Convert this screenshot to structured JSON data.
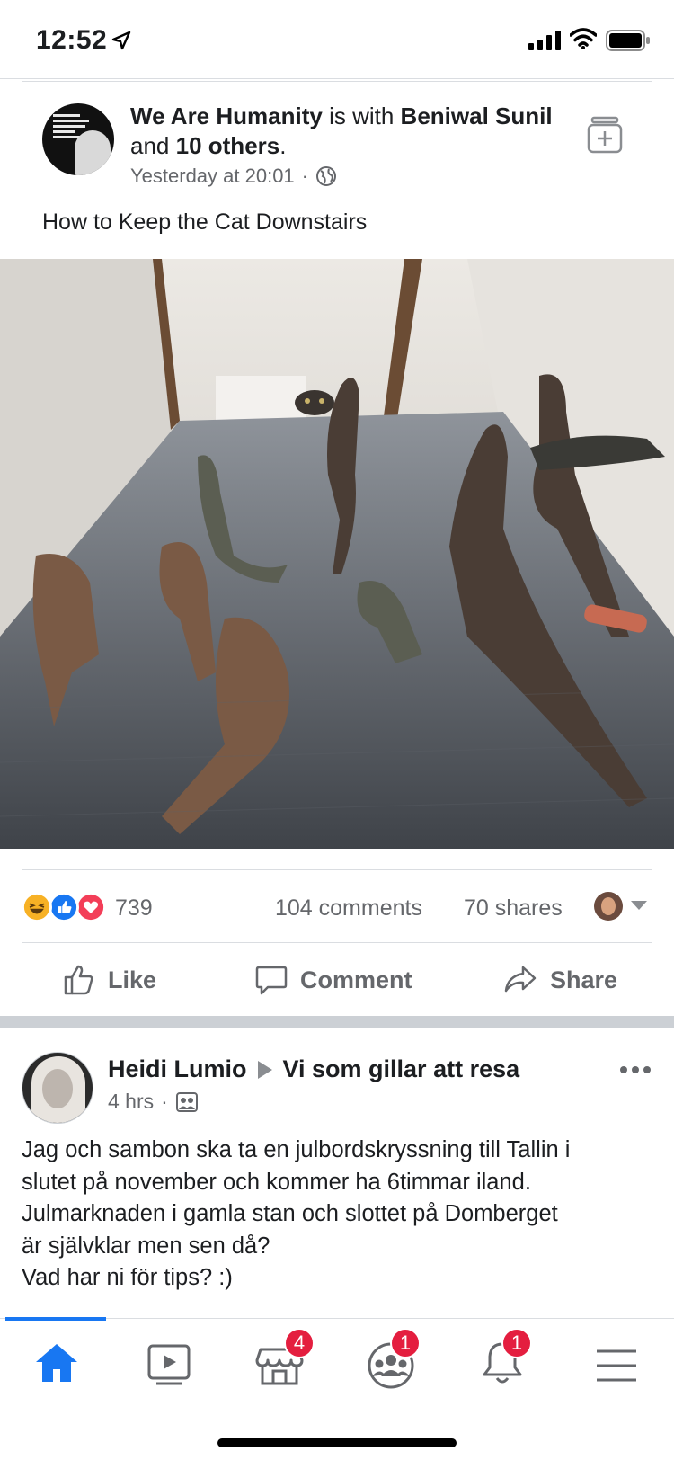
{
  "status_bar": {
    "time": "12:52"
  },
  "post1": {
    "page_name": "We Are Humanity",
    "with_text": "is with",
    "tagged_name": "Beniwal Sunil",
    "and_text": "and",
    "others": "10 others",
    "period": ".",
    "timestamp": "Yesterday at 20:01",
    "separator": "·",
    "text": "How to Keep the Cat Downstairs",
    "reactions_count": "739",
    "comments": "104 comments",
    "shares": "70 shares",
    "actions": {
      "like": "Like",
      "comment": "Comment",
      "share": "Share"
    }
  },
  "post2": {
    "author": "Heidi Lumio",
    "group": "Vi som gillar att resa",
    "time": "4 hrs",
    "separator": "·",
    "body_lines": [
      "Jag och sambon ska ta en julbordskryssning till Tallin i",
      "slutet på november och kommer ha 6timmar iland.",
      "Julmarknaden i gamla stan och slottet på Domberget",
      "är självklar men sen då?",
      "Vad har ni för tips? :)"
    ]
  },
  "tabbar": {
    "marketplace_badge": "4",
    "groups_badge": "1",
    "notifications_badge": "1",
    "active_color": "#1877f2",
    "icons": [
      "home-icon",
      "watch-icon",
      "marketplace-icon",
      "groups-icon",
      "notifications-icon",
      "menu-icon"
    ]
  },
  "colors": {
    "accent": "#1877f2",
    "badge": "#e41e3f",
    "secondary_text": "#65676b"
  }
}
